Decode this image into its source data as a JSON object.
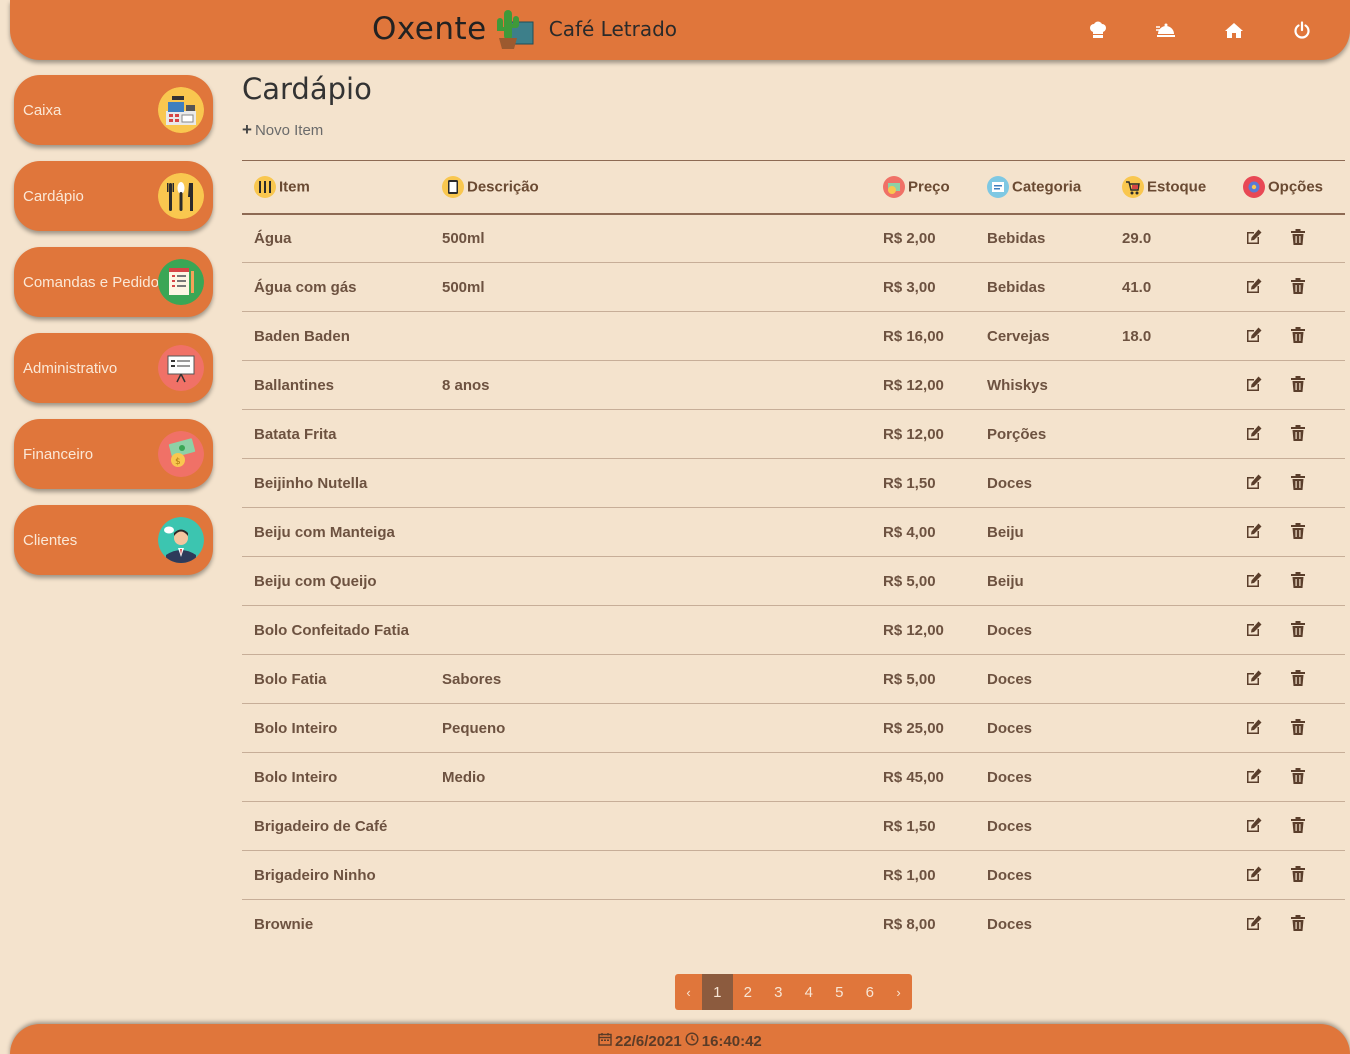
{
  "header": {
    "logo_text": "Oxente",
    "cafe_name": "Café Letrado",
    "icons": [
      "chef-hat-icon",
      "serving-cloche-icon",
      "home-icon",
      "power-icon"
    ]
  },
  "sidebar": {
    "items": [
      {
        "label": "Caixa",
        "icon": "cash-register-icon"
      },
      {
        "label": "Cardápio",
        "icon": "cutlery-icon"
      },
      {
        "label": "Comandas e Pedidos",
        "icon": "order-pad-icon"
      },
      {
        "label": "Administrativo",
        "icon": "presentation-board-icon"
      },
      {
        "label": "Financeiro",
        "icon": "money-icon"
      },
      {
        "label": "Clientes",
        "icon": "customer-avatar-icon"
      }
    ]
  },
  "main": {
    "title": "Cardápio",
    "new_item_label": "Novo Item",
    "columns": [
      "Item",
      "Descrição",
      "Preço",
      "Categoria",
      "Estoque",
      "Opções"
    ],
    "rows": [
      {
        "item": "Água",
        "descricao": "500ml",
        "preco": "R$ 2,00",
        "categoria": "Bebidas",
        "estoque": "29.0"
      },
      {
        "item": "Água com gás",
        "descricao": "500ml",
        "preco": "R$ 3,00",
        "categoria": "Bebidas",
        "estoque": "41.0"
      },
      {
        "item": "Baden Baden",
        "descricao": "",
        "preco": "R$ 16,00",
        "categoria": "Cervejas",
        "estoque": "18.0"
      },
      {
        "item": "Ballantines",
        "descricao": "8 anos",
        "preco": "R$ 12,00",
        "categoria": "Whiskys",
        "estoque": ""
      },
      {
        "item": "Batata Frita",
        "descricao": "",
        "preco": "R$ 12,00",
        "categoria": "Porções",
        "estoque": ""
      },
      {
        "item": "Beijinho Nutella",
        "descricao": "",
        "preco": "R$ 1,50",
        "categoria": "Doces",
        "estoque": ""
      },
      {
        "item": "Beiju com Manteiga",
        "descricao": "",
        "preco": "R$ 4,00",
        "categoria": "Beiju",
        "estoque": ""
      },
      {
        "item": "Beiju com Queijo",
        "descricao": "",
        "preco": "R$ 5,00",
        "categoria": "Beiju",
        "estoque": ""
      },
      {
        "item": "Bolo Confeitado Fatia",
        "descricao": "",
        "preco": "R$ 12,00",
        "categoria": "Doces",
        "estoque": ""
      },
      {
        "item": "Bolo Fatia",
        "descricao": "Sabores",
        "preco": "R$ 5,00",
        "categoria": "Doces",
        "estoque": ""
      },
      {
        "item": "Bolo Inteiro",
        "descricao": "Pequeno",
        "preco": "R$ 25,00",
        "categoria": "Doces",
        "estoque": ""
      },
      {
        "item": "Bolo Inteiro",
        "descricao": "Medio",
        "preco": "R$ 45,00",
        "categoria": "Doces",
        "estoque": ""
      },
      {
        "item": "Brigadeiro de Café",
        "descricao": "",
        "preco": "R$ 1,50",
        "categoria": "Doces",
        "estoque": ""
      },
      {
        "item": "Brigadeiro Ninho",
        "descricao": "",
        "preco": "R$ 1,00",
        "categoria": "Doces",
        "estoque": ""
      },
      {
        "item": "Brownie",
        "descricao": "",
        "preco": "R$ 8,00",
        "categoria": "Doces",
        "estoque": ""
      }
    ]
  },
  "pagination": {
    "prev": "‹",
    "pages": [
      "1",
      "2",
      "3",
      "4",
      "5",
      "6"
    ],
    "active_page": "1",
    "next": "›"
  },
  "footer": {
    "date": "22/6/2021",
    "time": "16:40:42"
  },
  "colors": {
    "accent": "#e0763b",
    "background": "#f4e3cd",
    "active_page": "#8c5b3e",
    "text": "#6d5240"
  }
}
